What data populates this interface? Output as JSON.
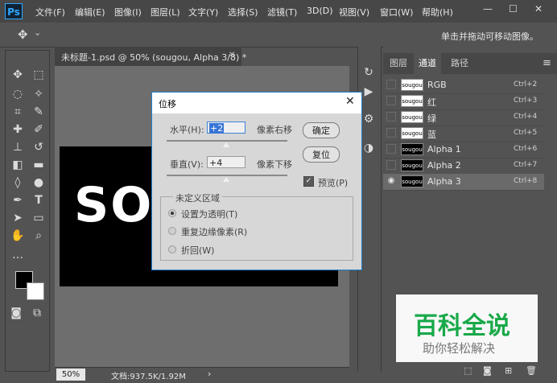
{
  "app": {
    "logo": "Ps"
  },
  "menu": [
    "文件(F)",
    "编辑(E)",
    "图像(I)",
    "图层(L)",
    "文字(Y)",
    "选择(S)",
    "滤镜(T)",
    "3D(D)",
    "视图(V)",
    "窗口(W)",
    "帮助(H)"
  ],
  "window_controls": {
    "minimize": "—",
    "restore": "☐",
    "close": "✕"
  },
  "options_bar": {
    "move_icon": "✥",
    "dropdown": "⌄",
    "hint": "单击并拖动可移动图像。"
  },
  "document": {
    "tab_title": "未标题-1.psd @ 50% (sougou, Alpha 3/8) *",
    "tab_close": "✕",
    "canvas_text": "SO",
    "zoom": "50%",
    "doc_info": "文档:937.5K/1.92M",
    "status_arrow": "›"
  },
  "panel": {
    "tabs": [
      "图层",
      "通道",
      "路径"
    ],
    "active_tab": 1,
    "menu_icon": "≡",
    "channels": [
      {
        "name": "RGB",
        "shortcut": "Ctrl+2",
        "thumb": "sougou",
        "dark": false,
        "visible": false,
        "selected": false
      },
      {
        "name": "红",
        "shortcut": "Ctrl+3",
        "thumb": "sougou",
        "dark": false,
        "visible": false,
        "selected": false
      },
      {
        "name": "绿",
        "shortcut": "Ctrl+4",
        "thumb": "sougou",
        "dark": false,
        "visible": false,
        "selected": false
      },
      {
        "name": "蓝",
        "shortcut": "Ctrl+5",
        "thumb": "sougou",
        "dark": false,
        "visible": false,
        "selected": false
      },
      {
        "name": "Alpha 1",
        "shortcut": "Ctrl+6",
        "thumb": "sougou",
        "dark": true,
        "visible": false,
        "selected": false
      },
      {
        "name": "Alpha 2",
        "shortcut": "Ctrl+7",
        "thumb": "sougou",
        "dark": true,
        "visible": false,
        "selected": false
      },
      {
        "name": "Alpha 3",
        "shortcut": "Ctrl+8",
        "thumb": "sougou",
        "dark": true,
        "visible": true,
        "selected": true
      }
    ]
  },
  "dialog": {
    "title": "位移",
    "close": "✕",
    "horizontal_label": "水平(H):",
    "horizontal_value": "+2",
    "horizontal_unit": "像素右移",
    "vertical_label": "垂直(V):",
    "vertical_value": "+4",
    "vertical_unit": "像素下移",
    "ok": "确定",
    "reset": "复位",
    "preview_label": "预览(P)",
    "preview_checked": true,
    "group_title": "未定义区域",
    "options": [
      "设置为透明(T)",
      "重复边缘像素(R)",
      "折回(W)"
    ],
    "selected_option": 0
  },
  "watermark": {
    "title": "百科全说",
    "subtitle": "助你轻松解决"
  },
  "colors": {
    "accent": "#31a8ff",
    "watermark_green": "#19a94a",
    "dialog_border": "#1e7fd0"
  }
}
